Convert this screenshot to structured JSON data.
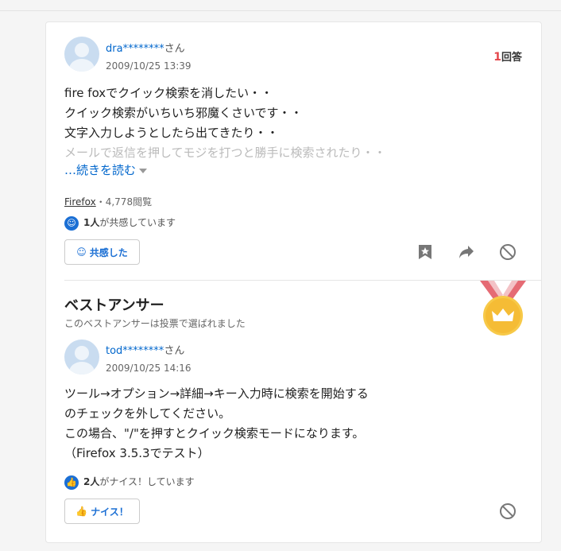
{
  "question": {
    "user_name": "dra********",
    "user_suffix": "さん",
    "date": "2009/10/25 13:39",
    "answer_count_num": "1",
    "answer_count_label": "回答",
    "lines": [
      "fire foxでクイック検索を消したい・・",
      "クイック検索がいちいち邪魔くさいです・・",
      "文字入力しようとしたら出てきたり・・",
      "メールで返信を押してモジを打つと勝手に検索されたり・・"
    ],
    "read_more": "…続きを読む",
    "category": "Firefox",
    "views": "・4,778閲覧",
    "empathy_count": "1人",
    "empathy_text": "が共感しています",
    "empathy_button": "共感した"
  },
  "best_answer": {
    "title": "ベストアンサー",
    "subtitle": "このベストアンサーは投票で選ばれました",
    "user_name": "tod********",
    "user_suffix": "さん",
    "date": "2009/10/25 14:16",
    "lines": [
      "ツール→オプション→詳細→キー入力時に検索を開始する",
      "のチェックを外してください。",
      "この場合、\"/\"を押すとクイック検索モードになります。",
      "（Firefox 3.5.3でテスト）"
    ],
    "nice_count": "2人",
    "nice_text": "がナイス！しています",
    "nice_button": "ナイス！"
  },
  "icons": {
    "bookmark": "bookmark-icon",
    "share": "share-icon",
    "block": "block-icon",
    "smile": "smile-icon",
    "thumbs_up": "thumbs-up-icon",
    "medal": "crown-medal-icon"
  },
  "colors": {
    "link": "#0066cc",
    "accent_red": "#e4464b",
    "button_blue": "#1b6fd4",
    "medal_gold": "#f7c948",
    "ribbon": "#e56b74"
  }
}
